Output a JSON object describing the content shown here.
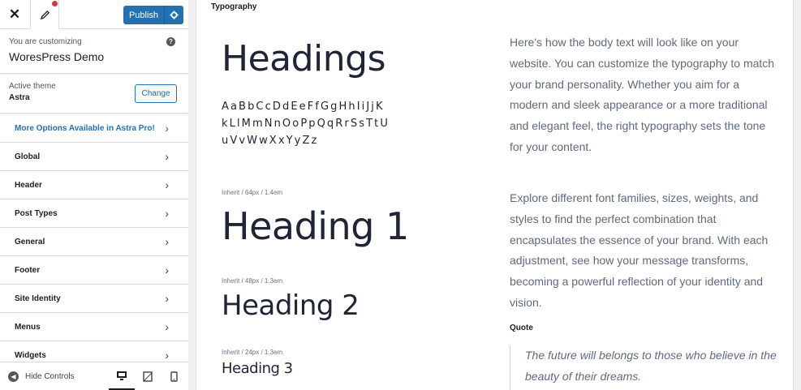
{
  "header": {
    "close_icon": "close-icon",
    "edit_icon": "brush-icon",
    "publish_label": "Publish",
    "settings_icon": "gear-icon",
    "publish_color": "#2271b1"
  },
  "info": {
    "customizing_label": "You are customizing",
    "site_name": "WoresPress Demo",
    "help_icon": "?"
  },
  "theme": {
    "label": "Active theme",
    "name": "Astra",
    "change_label": "Change"
  },
  "sidebar": {
    "items": [
      {
        "label": "More Options Available in Astra Pro!",
        "pro": true
      },
      {
        "label": "Global"
      },
      {
        "label": "Header"
      },
      {
        "label": "Post Types"
      },
      {
        "label": "General"
      },
      {
        "label": "Footer"
      },
      {
        "label": "Site Identity"
      },
      {
        "label": "Menus"
      },
      {
        "label": "Widgets"
      }
    ]
  },
  "footer": {
    "hide_controls_label": "Hide Controls",
    "devices": [
      "desktop-icon",
      "tablet-icon",
      "mobile-icon"
    ],
    "active_device": "desktop"
  },
  "preview": {
    "section_title": "Typography",
    "headings_title": "Headings",
    "alphabet": [
      "AaBbCcDdEeFfGgHhIiJjK",
      "kLlMmNnOoPpQqRrSsTtU",
      "uVvWwXxYyZz"
    ],
    "h1": {
      "meta": "Inherit / 64px / 1.4em",
      "text": "Heading 1"
    },
    "h2": {
      "meta": "Inherit / 48px / 1.3em",
      "text": "Heading 2"
    },
    "h3": {
      "meta": "Inherit / 24px / 1.3em",
      "text": "Heading 3"
    },
    "para1": "Here's how the body text will look like on your website. You can customize the typography to match your brand personality. Whether you aim for a modern and sleek appearance or a more traditional and elegant feel, the right typography sets the tone for your content.",
    "para2": "Explore different font families, sizes, weights, and styles to find the perfect combination that encapsulates the essence of your brand. With each adjustment, see how your message transforms, becoming a powerful reflection of your identity and vision.",
    "quote_label": "Quote",
    "quote_text": "The future will belongs to those who believe in the beauty of their dreams."
  }
}
